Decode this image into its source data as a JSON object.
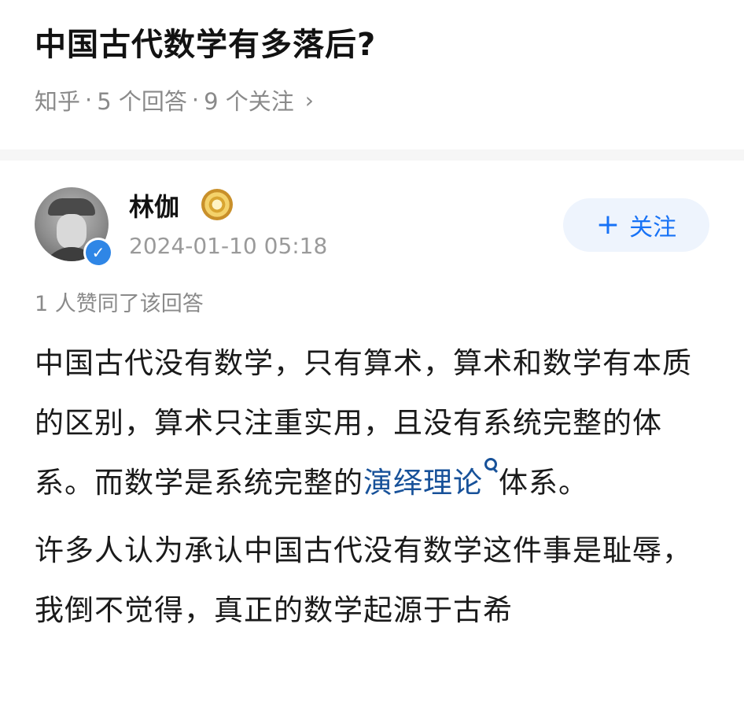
{
  "question": {
    "title": "中国古代数学有多落后?",
    "meta": {
      "source": "知乎",
      "answers": "5 个回答",
      "follows": "9 个关注",
      "separator": "·",
      "chevron": "›"
    }
  },
  "answer": {
    "author": {
      "name": "林伽",
      "badge_icon": "gold-medal-icon",
      "verified_icon": "verified-check-icon",
      "timestamp": "2024-01-10 05:18"
    },
    "follow_button": {
      "plus": "+",
      "label": "关注"
    },
    "likes_text": "1 人赞同了该回答",
    "paragraph1": {
      "before_link": "中国古代没有数学，只有算术，算术和数学有本质的区别，算术只注重实用，且没有系统完整的体系。而数学是系统完整的",
      "link": "演绎理论",
      "after_link": "体系。"
    },
    "paragraph2": "许多人认为承认中国古代没有数学这件事是耻辱，我倒不觉得，真正的数学起源于古希"
  },
  "colors": {
    "link": "#175199",
    "follow_text": "#1772f6",
    "follow_bg": "#eef4fd",
    "meta_gray": "#8a8a8a",
    "verify_blue": "#2f86e6"
  }
}
